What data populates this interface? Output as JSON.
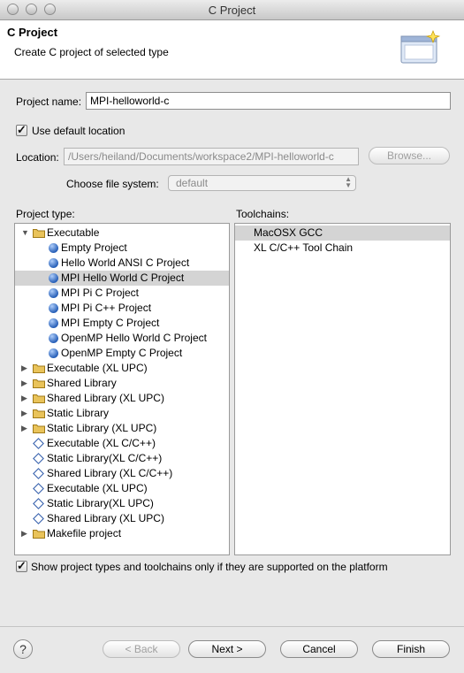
{
  "window": {
    "title": "C Project"
  },
  "banner": {
    "heading": "C Project",
    "description": "Create C project of selected type"
  },
  "form": {
    "project_name_label": "Project name:",
    "project_name_value": "MPI-helloworld-c",
    "use_default_location_label": "Use default location",
    "use_default_location_checked": true,
    "location_label": "Location:",
    "location_value": "/Users/heiland/Documents/workspace2/MPI-helloworld-c",
    "browse_label": "Browse...",
    "file_system_label": "Choose file system:",
    "file_system_value": "default"
  },
  "project_type": {
    "label": "Project type:",
    "items": [
      {
        "label": "Executable",
        "icon": "folder-icon",
        "expanded": true,
        "level": 0
      },
      {
        "label": "Empty Project",
        "icon": "project-template-icon",
        "level": 1
      },
      {
        "label": "Hello World ANSI C Project",
        "icon": "project-template-icon",
        "level": 1
      },
      {
        "label": "MPI Hello World C Project",
        "icon": "project-template-icon",
        "level": 1,
        "selected": true
      },
      {
        "label": "MPI Pi C Project",
        "icon": "project-template-icon",
        "level": 1
      },
      {
        "label": "MPI Pi C++ Project",
        "icon": "project-template-icon",
        "level": 1
      },
      {
        "label": "MPI Empty C Project",
        "icon": "project-template-icon",
        "level": 1
      },
      {
        "label": "OpenMP Hello World C Project",
        "icon": "project-template-icon",
        "level": 1
      },
      {
        "label": "OpenMP Empty C Project",
        "icon": "project-template-icon",
        "level": 1
      },
      {
        "label": "Executable (XL UPC)",
        "icon": "folder-icon",
        "expanded": false,
        "level": 0
      },
      {
        "label": "Shared Library",
        "icon": "folder-icon",
        "expanded": false,
        "level": 0
      },
      {
        "label": "Shared Library (XL UPC)",
        "icon": "folder-icon",
        "expanded": false,
        "level": 0
      },
      {
        "label": "Static Library",
        "icon": "folder-icon",
        "expanded": false,
        "level": 0
      },
      {
        "label": "Static Library (XL UPC)",
        "icon": "folder-icon",
        "expanded": false,
        "level": 0
      },
      {
        "label": "Executable (XL C/C++)",
        "icon": "diamond-icon",
        "level": 0
      },
      {
        "label": "Static Library(XL C/C++)",
        "icon": "diamond-icon",
        "level": 0
      },
      {
        "label": "Shared Library (XL C/C++)",
        "icon": "diamond-icon",
        "level": 0
      },
      {
        "label": "Executable (XL UPC)",
        "icon": "diamond-icon",
        "level": 0
      },
      {
        "label": "Static Library(XL UPC)",
        "icon": "diamond-icon",
        "level": 0
      },
      {
        "label": "Shared Library (XL UPC)",
        "icon": "diamond-icon",
        "level": 0
      },
      {
        "label": "Makefile project",
        "icon": "folder-icon",
        "expanded": false,
        "level": 0
      }
    ]
  },
  "toolchains": {
    "label": "Toolchains:",
    "items": [
      {
        "label": "MacOSX GCC",
        "selected": true
      },
      {
        "label": "XL C/C++ Tool Chain",
        "selected": false
      }
    ]
  },
  "show_supported": {
    "label": "Show project types and toolchains only if they are supported on the platform",
    "checked": true
  },
  "buttons": {
    "help": "?",
    "back": "< Back",
    "next": "Next >",
    "cancel": "Cancel",
    "finish": "Finish"
  },
  "colors": {
    "selection": "#d4d4d4",
    "bullet": "#2860b8",
    "folder": "#e9c35a"
  }
}
